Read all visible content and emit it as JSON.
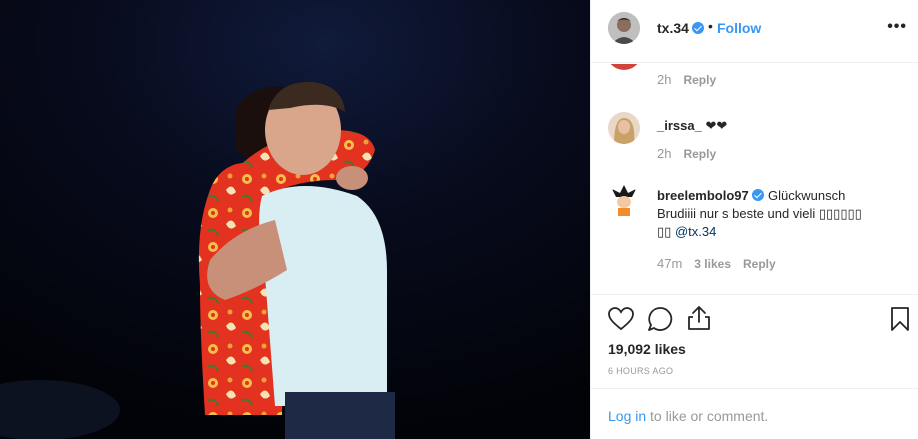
{
  "post": {
    "image_alt": "",
    "colors": {
      "shirt_red": "#e3321f",
      "shirt_accent": "#f2a13a",
      "tshirt": "#d9eef2",
      "background": "#04050c"
    }
  },
  "header": {
    "username": "tx.34",
    "verified_icon": "verified-badge-icon",
    "separator": "•",
    "follow_label": "Follow",
    "more_label": "•••"
  },
  "comments": [
    {
      "username": "",
      "text": "",
      "time": "2h",
      "likes": "",
      "reply_label": "Reply"
    },
    {
      "username": "_irssa_",
      "text": "❤❤",
      "time": "2h",
      "likes": "",
      "reply_label": "Reply"
    },
    {
      "username": "breelembolo97",
      "verified": true,
      "text_line1": "Glückwunsch",
      "text_line2": "Brudiiii nur s beste und vieli",
      "text_glyphs_1": "▯▯▯▯▯▯",
      "text_glyphs_2": "▯▯",
      "mention": "@tx.34",
      "time": "47m",
      "likes": "3 likes",
      "reply_label": "Reply"
    }
  ],
  "actions": {
    "like_icon": "heart-icon",
    "comment_icon": "comment-icon",
    "share_icon": "share-icon",
    "save_icon": "bookmark-icon",
    "likes_count": "19,092 likes",
    "timestamp": "6 HOURS AGO"
  },
  "login_bar": {
    "login_label": "Log in",
    "suffix": "to like or comment."
  }
}
